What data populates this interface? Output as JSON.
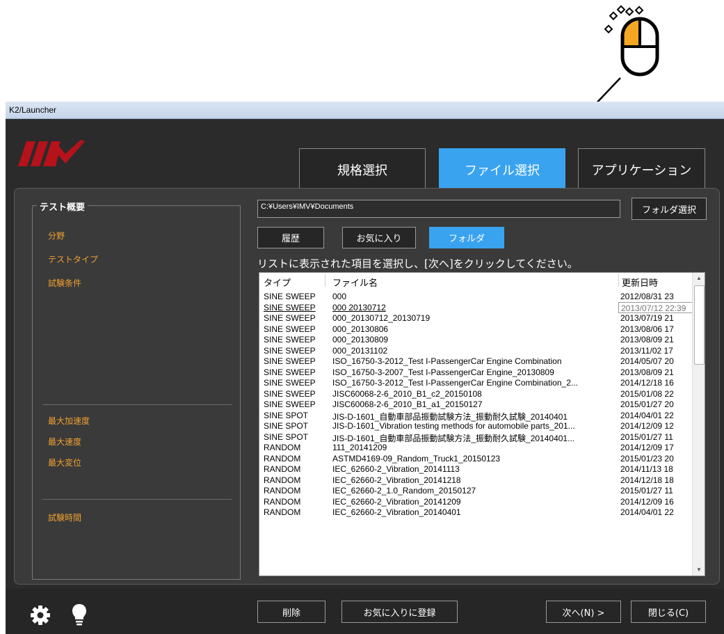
{
  "window": {
    "title": "K2/Launcher"
  },
  "header": {
    "tabs": [
      {
        "label": "規格選択",
        "active": false
      },
      {
        "label": "ファイル選択",
        "active": true
      },
      {
        "label": "アプリケーション",
        "active": false
      }
    ]
  },
  "overview": {
    "title": "テスト概要",
    "items": [
      "分野",
      "テストタイプ",
      "試験条件"
    ],
    "limits": [
      "最大加速度",
      "最大速度",
      "最大変位"
    ],
    "time": "試験時間"
  },
  "path": {
    "value": "C:¥Users¥IMV¥Documents",
    "select_label": "フォルダ選択"
  },
  "source_tabs": [
    {
      "label": "履歴",
      "active": false
    },
    {
      "label": "お気に入り",
      "active": false
    },
    {
      "label": "フォルダ",
      "active": true
    }
  ],
  "instruction": "リストに表示された項目を選択し、[次へ]をクリックしてください。",
  "list": {
    "columns": [
      "タイプ",
      "ファイル名",
      "更新日時"
    ],
    "tooltip": "2013/07/12 22:39",
    "rows": [
      {
        "type": "SINE SWEEP",
        "name": "000",
        "date": "2012/08/31 23"
      },
      {
        "type": "SINE SWEEP",
        "name": "000 20130712",
        "date": "2013/07/12 22:39"
      },
      {
        "type": "SINE SWEEP",
        "name": "000_20130712_20130719",
        "date": "2013/07/19 21"
      },
      {
        "type": "SINE SWEEP",
        "name": "000_20130806",
        "date": "2013/08/06 17"
      },
      {
        "type": "SINE SWEEP",
        "name": "000_20130809",
        "date": "2013/08/09 21"
      },
      {
        "type": "SINE SWEEP",
        "name": "000_20131102",
        "date": "2013/11/02 17"
      },
      {
        "type": "SINE SWEEP",
        "name": "ISO_16750-3-2012_Test I-PassengerCar Engine Combination",
        "date": "2014/05/07 20"
      },
      {
        "type": "SINE SWEEP",
        "name": "ISO_16750-3-2007_Test I-PassengerCar Engine_20130809",
        "date": "2013/08/09 21"
      },
      {
        "type": "SINE SWEEP",
        "name": "ISO_16750-3-2012_Test I-PassengerCar Engine Combination_2...",
        "date": "2014/12/18 16"
      },
      {
        "type": "SINE SWEEP",
        "name": "JISC60068-2-6_2010_B1_c2_20150108",
        "date": "2015/01/08 22"
      },
      {
        "type": "SINE SWEEP",
        "name": "JISC60068-2-6_2010_B1_a1_20150127",
        "date": "2015/01/27 20"
      },
      {
        "type": "SINE SPOT",
        "name": "JIS-D-1601_自動車部品振動試験方法_振動耐久試験_20140401",
        "date": "2014/04/01 22"
      },
      {
        "type": "SINE SPOT",
        "name": "JIS-D-1601_Vibration testing methods for automobile parts_201...",
        "date": "2014/12/09 12"
      },
      {
        "type": "SINE SPOT",
        "name": "JIS-D-1601_自動車部品振動試験方法_振動耐久試験_20140401...",
        "date": "2015/01/27 11"
      },
      {
        "type": "RANDOM",
        "name": "111_20141209",
        "date": "2014/12/09 17"
      },
      {
        "type": "RANDOM",
        "name": "ASTMD4169-09_Random_Truck1_20150123",
        "date": "2015/01/23 20"
      },
      {
        "type": "RANDOM",
        "name": "IEC_62660-2_Vibration_20141113",
        "date": "2014/11/13 18"
      },
      {
        "type": "RANDOM",
        "name": "IEC_62660-2_Vibration_20141218",
        "date": "2014/12/18 18"
      },
      {
        "type": "RANDOM",
        "name": "IEC_62660-2_1.0_Random_20150127",
        "date": "2015/01/27 11"
      },
      {
        "type": "RANDOM",
        "name": "IEC_62660-2_Vibration_20141209",
        "date": "2014/12/09 16"
      },
      {
        "type": "RANDOM",
        "name": "IEC_62660-2_Vibration_20140401",
        "date": "2014/04/01 22"
      }
    ]
  },
  "footer": {
    "delete_label": "削除",
    "favorite_label": "お気に入りに登録",
    "next_label": "次へ(N) >",
    "close_label": "閉じる(C)"
  },
  "colors": {
    "accent": "#3aa3f0",
    "label_orange": "#f0a030",
    "background": "#2b2b2b",
    "panel": "#3a3a3a"
  }
}
